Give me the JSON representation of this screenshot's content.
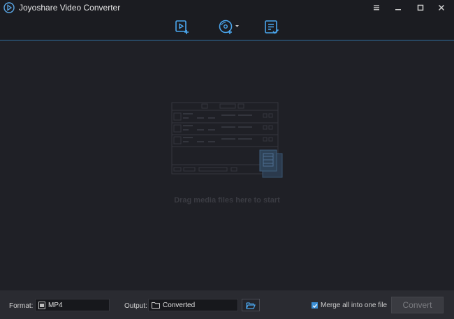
{
  "app": {
    "title": "Joyoshare Video Converter"
  },
  "toolbar": {
    "icons": [
      "add-video-icon",
      "add-dvd-icon",
      "history-list-icon"
    ]
  },
  "main": {
    "drop_hint": "Drag media files here to start"
  },
  "bottom": {
    "format_label": "Format:",
    "format_value": "MP4",
    "output_label": "Output:",
    "output_value": "Converted",
    "merge_label": "Merge all into one file",
    "merge_checked": true,
    "convert_label": "Convert"
  },
  "colors": {
    "accent": "#3b8fd6",
    "background": "#1f2026",
    "bar": "#1b1c21"
  }
}
